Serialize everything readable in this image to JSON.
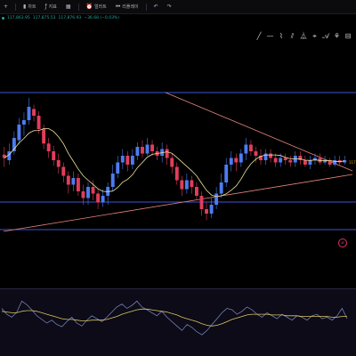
{
  "toolbar": {
    "items": [
      {
        "icon": "plus-icon",
        "glyph": "+",
        "label": ""
      },
      {
        "icon": "candle-icon",
        "glyph": "▮",
        "label": "차트"
      },
      {
        "icon": "indicator-icon",
        "glyph": "ƒ",
        "label": "지표"
      },
      {
        "icon": "layout-icon",
        "glyph": "▦",
        "label": ""
      },
      {
        "icon": "alert-icon",
        "glyph": "⏰",
        "label": "얼러트"
      },
      {
        "icon": "replay-icon",
        "glyph": "⏮",
        "label": "리플레이"
      },
      {
        "icon": "undo-icon",
        "glyph": "↶",
        "label": ""
      },
      {
        "icon": "redo-icon",
        "glyph": "↷",
        "label": ""
      }
    ]
  },
  "ohlc": {
    "open": "117,863.95",
    "high": "117,875.53",
    "low": "117,876.93",
    "change": "−36.68 (−0.03%)"
  },
  "drawing_tools": [
    "╱",
    "—",
    "⌇",
    "⫽",
    "⏅",
    "⌖",
    "𝒜",
    "⚘",
    "⊟"
  ],
  "price_marker": "117",
  "colors": {
    "up": "#4c7cf0",
    "down": "#e23d5b",
    "ma": "#f0e6a0",
    "trendline": "#e8867a",
    "channel": "#3c55d8",
    "osc_line": "#7b8cc9",
    "osc_signal": "#d8c560"
  },
  "chart_data": {
    "type": "candlestick",
    "candles": [
      [
        195,
        192,
        184,
        202
      ],
      [
        190,
        198,
        186,
        205
      ],
      [
        198,
        210,
        195,
        216
      ],
      [
        208,
        222,
        204,
        228
      ],
      [
        222,
        226,
        212,
        233
      ],
      [
        226,
        238,
        222,
        246
      ],
      [
        236,
        230,
        225,
        240
      ],
      [
        230,
        218,
        214,
        234
      ],
      [
        218,
        205,
        200,
        222
      ],
      [
        205,
        198,
        192,
        210
      ],
      [
        198,
        190,
        185,
        203
      ],
      [
        190,
        184,
        178,
        196
      ],
      [
        184,
        176,
        170,
        188
      ],
      [
        176,
        168,
        160,
        180
      ],
      [
        168,
        174,
        162,
        180
      ],
      [
        174,
        162,
        158,
        178
      ],
      [
        162,
        156,
        150,
        168
      ],
      [
        156,
        166,
        150,
        170
      ],
      [
        166,
        160,
        154,
        172
      ],
      [
        160,
        152,
        146,
        164
      ],
      [
        152,
        158,
        148,
        164
      ],
      [
        158,
        166,
        150,
        170
      ],
      [
        166,
        178,
        162,
        186
      ],
      [
        178,
        188,
        174,
        194
      ],
      [
        188,
        194,
        182,
        200
      ],
      [
        194,
        186,
        180,
        198
      ],
      [
        186,
        194,
        182,
        200
      ],
      [
        194,
        202,
        190,
        206
      ],
      [
        202,
        196,
        192,
        208
      ],
      [
        196,
        204,
        194,
        210
      ],
      [
        204,
        198,
        194,
        208
      ],
      [
        198,
        194,
        190,
        202
      ],
      [
        194,
        200,
        188,
        206
      ],
      [
        200,
        192,
        186,
        204
      ],
      [
        192,
        184,
        178,
        196
      ],
      [
        184,
        172,
        168,
        188
      ],
      [
        172,
        164,
        158,
        176
      ],
      [
        164,
        172,
        160,
        178
      ],
      [
        172,
        166,
        160,
        176
      ],
      [
        166,
        158,
        154,
        170
      ],
      [
        158,
        146,
        140,
        162
      ],
      [
        146,
        142,
        136,
        152
      ],
      [
        142,
        150,
        138,
        156
      ],
      [
        150,
        160,
        146,
        166
      ],
      [
        160,
        170,
        156,
        178
      ],
      [
        170,
        186,
        166,
        192
      ],
      [
        186,
        192,
        180,
        198
      ],
      [
        192,
        188,
        180,
        196
      ],
      [
        188,
        196,
        184,
        200
      ],
      [
        196,
        204,
        190,
        210
      ],
      [
        204,
        198,
        194,
        208
      ],
      [
        198,
        194,
        188,
        202
      ],
      [
        194,
        190,
        186,
        200
      ],
      [
        190,
        196,
        186,
        200
      ],
      [
        196,
        192,
        188,
        200
      ],
      [
        192,
        188,
        184,
        196
      ],
      [
        188,
        192,
        184,
        196
      ],
      [
        192,
        190,
        186,
        196
      ],
      [
        190,
        188,
        184,
        194
      ],
      [
        188,
        194,
        184,
        198
      ],
      [
        194,
        190,
        186,
        198
      ],
      [
        190,
        186,
        184,
        194
      ],
      [
        186,
        190,
        182,
        194
      ],
      [
        190,
        192,
        186,
        196
      ],
      [
        192,
        188,
        186,
        196
      ],
      [
        188,
        190,
        186,
        194
      ],
      [
        190,
        186,
        184,
        192
      ],
      [
        186,
        190,
        184,
        194
      ],
      [
        190,
        188,
        186,
        194
      ],
      [
        188,
        190,
        186,
        194
      ]
    ],
    "oscillator": [
      60,
      52,
      48,
      55,
      70,
      65,
      58,
      50,
      45,
      40,
      44,
      38,
      35,
      42,
      48,
      40,
      36,
      44,
      50,
      46,
      42,
      48,
      55,
      62,
      66,
      60,
      64,
      70,
      62,
      58,
      54,
      50,
      56,
      48,
      42,
      36,
      30,
      38,
      34,
      28,
      24,
      30,
      38,
      46,
      54,
      60,
      58,
      52,
      56,
      62,
      58,
      52,
      48,
      54,
      50,
      46,
      52,
      48,
      44,
      50,
      48,
      44,
      50,
      52,
      46,
      48,
      44,
      50,
      60,
      46
    ],
    "osc_signal": [
      56,
      55,
      54,
      54,
      56,
      57,
      57,
      56,
      54,
      52,
      50,
      48,
      46,
      45,
      45,
      44,
      43,
      43,
      44,
      44,
      44,
      45,
      47,
      49,
      52,
      54,
      56,
      58,
      59,
      59,
      58,
      57,
      56,
      55,
      53,
      51,
      48,
      46,
      44,
      42,
      39,
      37,
      36,
      37,
      39,
      42,
      45,
      47,
      49,
      51,
      52,
      52,
      52,
      52,
      51,
      51,
      51,
      50,
      50,
      50,
      49,
      49,
      49,
      49,
      49,
      49,
      48,
      48,
      49,
      49
    ]
  }
}
